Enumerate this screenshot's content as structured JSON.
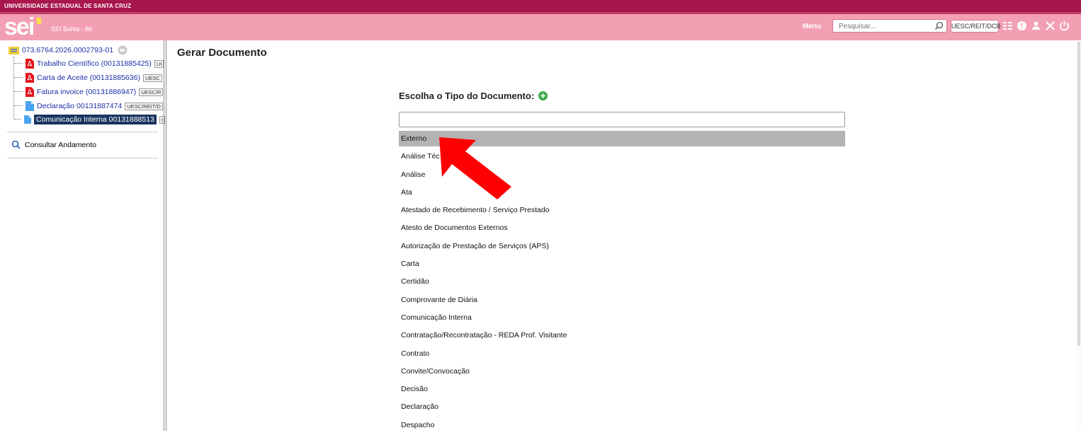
{
  "top_bar": {
    "institution": "UNIVERSIDADE ESTADUAL DE SANTA CRUZ"
  },
  "header": {
    "logo_text": "sei",
    "system_name": "SEI Bahia - 86",
    "menu_label": "Menu",
    "search_placeholder": "Pesquisar...",
    "unit_label": "UESC/REIT/DCB",
    "icons": [
      "search-icon",
      "controls-icon",
      "notification-icon",
      "user-icon",
      "tools-icon",
      "logout-icon"
    ]
  },
  "sidebar": {
    "process_number": "073.6764.2026.0002793-01",
    "documents": [
      {
        "label": "Trabalho Científico (00131885425)",
        "tag": "UI",
        "icon": "pdf-icon",
        "selected": false
      },
      {
        "label": "Carta de Aceite (00131885636)",
        "tag": "UESC",
        "icon": "pdf-icon",
        "selected": false
      },
      {
        "label": "Fatura invoice (00131886947)",
        "tag": "UESC/R",
        "icon": "pdf-icon",
        "selected": false
      },
      {
        "label": "Declaração 00131887474",
        "tag": "UESC/REIT/D",
        "icon": "document-icon",
        "selected": false
      },
      {
        "label": "Comunicação Interna 00131888513",
        "tag": "I",
        "icon": "document-icon",
        "selected": true
      }
    ],
    "consult_label": "Consultar Andamento"
  },
  "main": {
    "title": "Gerar Documento",
    "choose_label": "Escolha o Tipo do Documento:",
    "filter_value": "",
    "options": [
      "Externo",
      "Análise Téc",
      "Análise",
      "Ata",
      "Atestado de Recebimento / Serviço Prestado",
      "Atesto de Documentos Externos",
      "Autorização de Prestação de Serviços (APS)",
      "Carta",
      "Certidão",
      "Comprovante de Diária",
      "Comunicação Interna",
      "Contratação/Recontratação - REDA Prof. Visitante",
      "Contrato",
      "Convite/Convocação",
      "Decisão",
      "Declaração",
      "Despacho"
    ],
    "highlighted_index": 0
  },
  "colors": {
    "top_bar": "#a8174b",
    "header": "#f29fb3",
    "link": "#1b2fa8",
    "selected_bg": "#19355f",
    "highlight": "#b3b3b3",
    "annotation_arrow": "#ff0000"
  }
}
